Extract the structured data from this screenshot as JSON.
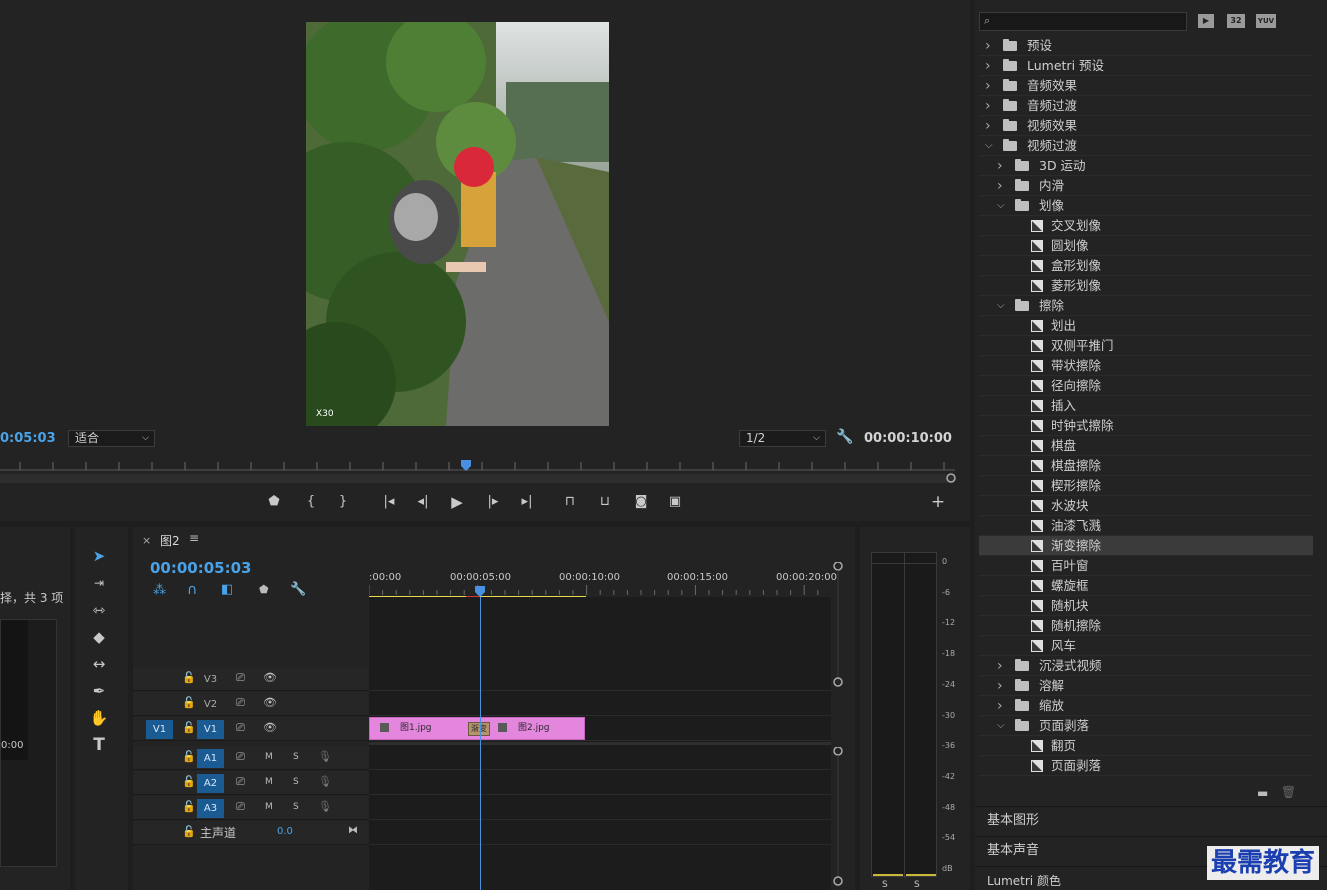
{
  "program": {
    "timecode_left": "0:05:03",
    "fit_label": "适合",
    "quality_label": "1/2",
    "duration": "00:00:10:00"
  },
  "project": {
    "text": "择，共 3 项",
    "tc": "0:00"
  },
  "timeline": {
    "close": "×",
    "seq_name": "图2",
    "menu": "≡",
    "timecode": "00:00:05:03",
    "ruler": [
      ":00:00",
      "00:00:05:00",
      "00:00:10:00",
      "00:00:15:00",
      "00:00:20:00"
    ],
    "tracks": {
      "v3": "V3",
      "v2": "V2",
      "v1": "V1",
      "v1_src": "V1",
      "a1": "A1",
      "a2": "A2",
      "a3": "A3",
      "m": "M",
      "s": "S",
      "master": "主声道",
      "master_val": "0.0"
    },
    "clips": {
      "clip1": "图1.jpg",
      "clip2": "图2.jpg",
      "transition": "渐变"
    }
  },
  "meter": {
    "scale": [
      "0",
      "-6",
      "-12",
      "-18",
      "-24",
      "-30",
      "-36",
      "-42",
      "-48",
      "-54",
      "dB"
    ],
    "bottom_left": "S",
    "bottom_right": "S"
  },
  "effects": {
    "toolbar": [
      "32",
      "YUV"
    ],
    "tree": [
      {
        "label": "预设",
        "indent": 0,
        "kind": "folder-star",
        "chev": "right"
      },
      {
        "label": "Lumetri 预设",
        "indent": 0,
        "kind": "folder-star",
        "chev": "right"
      },
      {
        "label": "音频效果",
        "indent": 0,
        "kind": "folder",
        "chev": "right"
      },
      {
        "label": "音频过渡",
        "indent": 0,
        "kind": "folder",
        "chev": "right"
      },
      {
        "label": "视频效果",
        "indent": 0,
        "kind": "folder",
        "chev": "right"
      },
      {
        "label": "视频过渡",
        "indent": 0,
        "kind": "folder",
        "chev": "down"
      },
      {
        "label": "3D 运动",
        "indent": 1,
        "kind": "folder",
        "chev": "right"
      },
      {
        "label": "内滑",
        "indent": 1,
        "kind": "folder",
        "chev": "right"
      },
      {
        "label": "划像",
        "indent": 1,
        "kind": "folder",
        "chev": "down"
      },
      {
        "label": "交叉划像",
        "indent": 2,
        "kind": "item"
      },
      {
        "label": "圆划像",
        "indent": 2,
        "kind": "item"
      },
      {
        "label": "盒形划像",
        "indent": 2,
        "kind": "item"
      },
      {
        "label": "菱形划像",
        "indent": 2,
        "kind": "item"
      },
      {
        "label": "擦除",
        "indent": 1,
        "kind": "folder",
        "chev": "down"
      },
      {
        "label": "划出",
        "indent": 2,
        "kind": "item"
      },
      {
        "label": "双侧平推门",
        "indent": 2,
        "kind": "item"
      },
      {
        "label": "带状擦除",
        "indent": 2,
        "kind": "item"
      },
      {
        "label": "径向擦除",
        "indent": 2,
        "kind": "item"
      },
      {
        "label": "插入",
        "indent": 2,
        "kind": "item"
      },
      {
        "label": "时钟式擦除",
        "indent": 2,
        "kind": "item"
      },
      {
        "label": "棋盘",
        "indent": 2,
        "kind": "item"
      },
      {
        "label": "棋盘擦除",
        "indent": 2,
        "kind": "item"
      },
      {
        "label": "楔形擦除",
        "indent": 2,
        "kind": "item"
      },
      {
        "label": "水波块",
        "indent": 2,
        "kind": "item"
      },
      {
        "label": "油漆飞溅",
        "indent": 2,
        "kind": "item"
      },
      {
        "label": "渐变擦除",
        "indent": 2,
        "kind": "item",
        "selected": true
      },
      {
        "label": "百叶窗",
        "indent": 2,
        "kind": "item"
      },
      {
        "label": "螺旋框",
        "indent": 2,
        "kind": "item"
      },
      {
        "label": "随机块",
        "indent": 2,
        "kind": "item"
      },
      {
        "label": "随机擦除",
        "indent": 2,
        "kind": "item"
      },
      {
        "label": "风车",
        "indent": 2,
        "kind": "item"
      },
      {
        "label": "沉浸式视频",
        "indent": 1,
        "kind": "folder",
        "chev": "right"
      },
      {
        "label": "溶解",
        "indent": 1,
        "kind": "folder",
        "chev": "right"
      },
      {
        "label": "缩放",
        "indent": 1,
        "kind": "folder",
        "chev": "right"
      },
      {
        "label": "页面剥落",
        "indent": 1,
        "kind": "folder",
        "chev": "down"
      },
      {
        "label": "翻页",
        "indent": 2,
        "kind": "item"
      },
      {
        "label": "页面剥落",
        "indent": 2,
        "kind": "item"
      }
    ],
    "sections": [
      "基本图形",
      "基本声音",
      "Lumetri 颜色"
    ]
  },
  "watermark": "最需教育",
  "colors": {
    "accent_blue": "#4aa3e8",
    "clip_pink": "#e486de",
    "playhead": "#4a90e2"
  }
}
